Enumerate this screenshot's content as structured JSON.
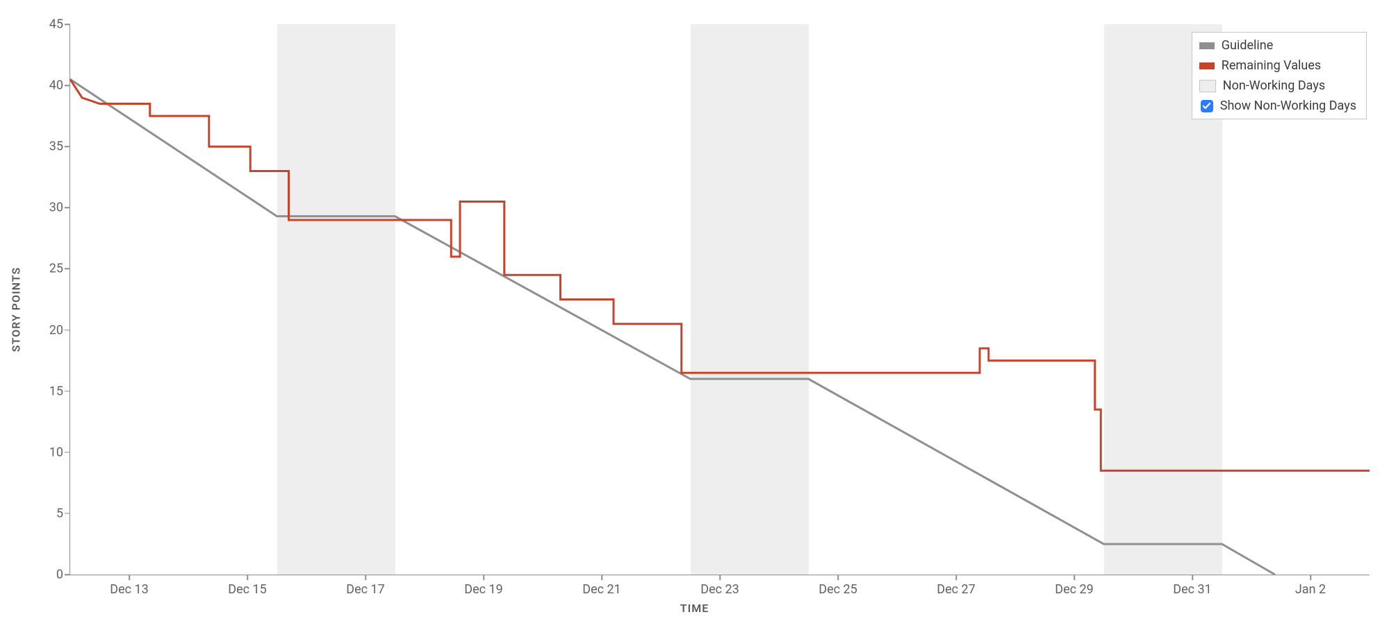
{
  "chart_data": {
    "type": "line",
    "xlabel": "TIME",
    "ylabel": "STORY POINTS",
    "ylim": [
      0,
      45
    ],
    "xlim": [
      "Dec 12",
      "Jan 3"
    ],
    "y_ticks": [
      0,
      5,
      10,
      15,
      20,
      25,
      30,
      35,
      40,
      45
    ],
    "x_ticks": [
      "Dec 13",
      "Dec 15",
      "Dec 17",
      "Dec 19",
      "Dec 21",
      "Dec 23",
      "Dec 25",
      "Dec 27",
      "Dec 29",
      "Dec 31",
      "Jan 2"
    ],
    "x_range_days": {
      "start": 0,
      "end": 22
    },
    "x_tick_positions_days": [
      1,
      3,
      5,
      7,
      9,
      11,
      13,
      15,
      17,
      19,
      21
    ],
    "non_working_days": [
      {
        "start": 3.5,
        "end": 5.5
      },
      {
        "start": 10.5,
        "end": 12.5
      },
      {
        "start": 17.5,
        "end": 19.5
      }
    ],
    "series": [
      {
        "name": "Guideline",
        "color": "#8f8f8f",
        "step": false,
        "points": [
          {
            "x": 0.0,
            "y": 40.5
          },
          {
            "x": 3.5,
            "y": 29.3
          },
          {
            "x": 5.5,
            "y": 29.3
          },
          {
            "x": 10.5,
            "y": 16.0
          },
          {
            "x": 12.5,
            "y": 16.0
          },
          {
            "x": 17.5,
            "y": 2.5
          },
          {
            "x": 19.5,
            "y": 2.5
          },
          {
            "x": 20.4,
            "y": 0.0
          }
        ]
      },
      {
        "name": "Remaining Values",
        "color": "#c8432c",
        "step": true,
        "points": [
          {
            "x": 0.0,
            "y": 40.5
          },
          {
            "x": 0.2,
            "y": 39.0
          },
          {
            "x": 0.5,
            "y": 38.5
          },
          {
            "x": 1.35,
            "y": 38.5
          },
          {
            "x": 1.35,
            "y": 37.5
          },
          {
            "x": 2.35,
            "y": 37.5
          },
          {
            "x": 2.35,
            "y": 35.0
          },
          {
            "x": 3.05,
            "y": 35.0
          },
          {
            "x": 3.05,
            "y": 33.0
          },
          {
            "x": 3.7,
            "y": 33.0
          },
          {
            "x": 3.7,
            "y": 29.0
          },
          {
            "x": 6.45,
            "y": 29.0
          },
          {
            "x": 6.45,
            "y": 26.0
          },
          {
            "x": 6.6,
            "y": 26.0
          },
          {
            "x": 6.6,
            "y": 30.5
          },
          {
            "x": 7.35,
            "y": 30.5
          },
          {
            "x": 7.35,
            "y": 24.5
          },
          {
            "x": 8.3,
            "y": 24.5
          },
          {
            "x": 8.3,
            "y": 22.5
          },
          {
            "x": 9.2,
            "y": 22.5
          },
          {
            "x": 9.2,
            "y": 20.5
          },
          {
            "x": 10.35,
            "y": 20.5
          },
          {
            "x": 10.35,
            "y": 16.5
          },
          {
            "x": 15.4,
            "y": 16.5
          },
          {
            "x": 15.4,
            "y": 18.5
          },
          {
            "x": 15.55,
            "y": 18.5
          },
          {
            "x": 15.55,
            "y": 17.5
          },
          {
            "x": 17.35,
            "y": 17.5
          },
          {
            "x": 17.35,
            "y": 13.5
          },
          {
            "x": 17.45,
            "y": 13.5
          },
          {
            "x": 17.45,
            "y": 8.5
          },
          {
            "x": 22.0,
            "y": 8.5
          }
        ]
      }
    ],
    "legend_entries": [
      {
        "label": "Guideline",
        "type": "line",
        "color": "#8f8f8f"
      },
      {
        "label": "Remaining Values",
        "type": "line",
        "color": "#c8432c"
      },
      {
        "label": "Non-Working Days",
        "type": "swatch",
        "color": "#eeeeee"
      }
    ],
    "legend_toggle": {
      "label": "Show Non-Working Days",
      "checked": true
    }
  }
}
